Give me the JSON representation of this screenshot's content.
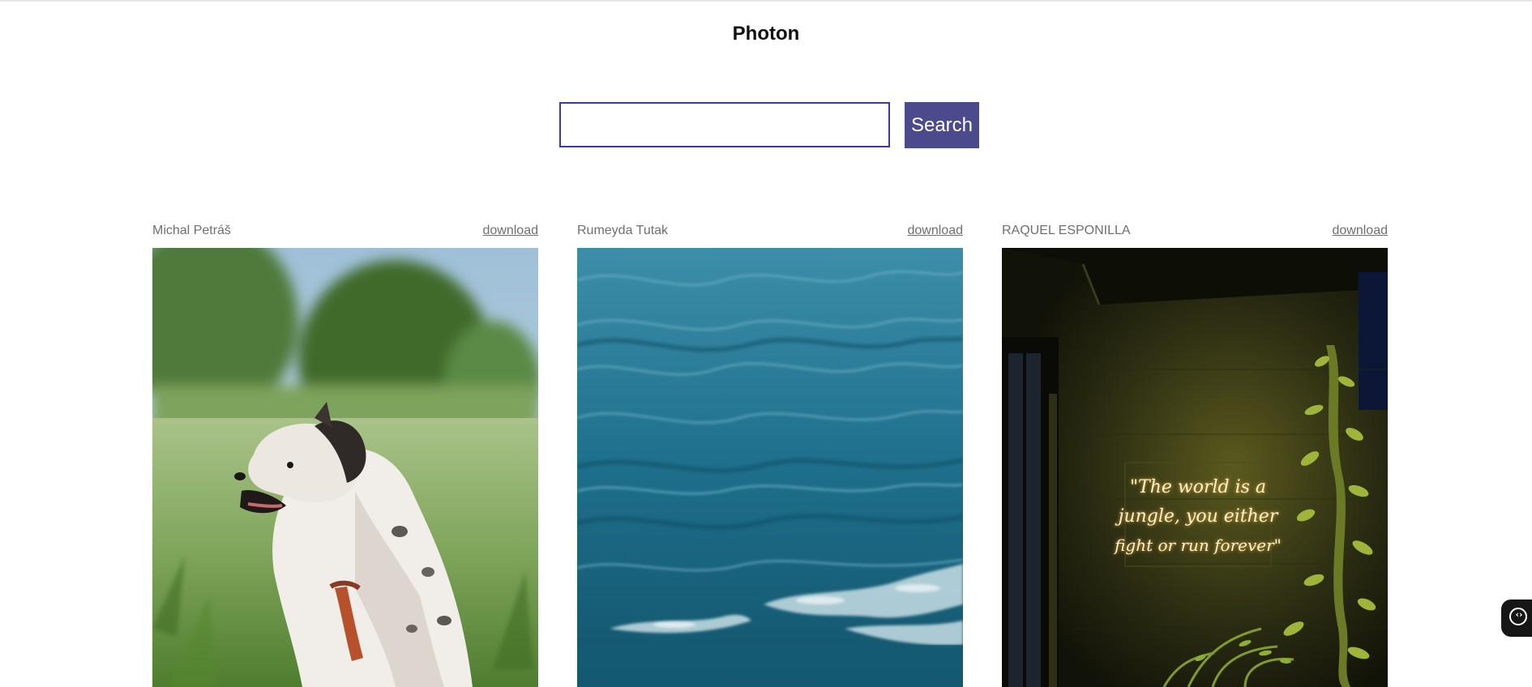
{
  "app": {
    "title": "Photon"
  },
  "search": {
    "placeholder": "",
    "value": "",
    "button_label": "Search"
  },
  "photos": [
    {
      "author": "Michal Petráš",
      "download_label": "download",
      "subject": "dog-in-meadow"
    },
    {
      "author": "Rumeyda Tutak",
      "download_label": "download",
      "subject": "ocean-waves"
    },
    {
      "author": "RAQUEL ESPONILLA",
      "download_label": "download",
      "subject": "neon-sign-plants",
      "neon_text": [
        "\"The world is a",
        "jungle, you either",
        "fight or run forever\""
      ]
    }
  ],
  "colors": {
    "accent": "#4b4a8c",
    "input_border": "#3c3aa0",
    "meta_text": "#6f6f6f"
  },
  "widget": {
    "icon": "code-brackets-icon"
  }
}
